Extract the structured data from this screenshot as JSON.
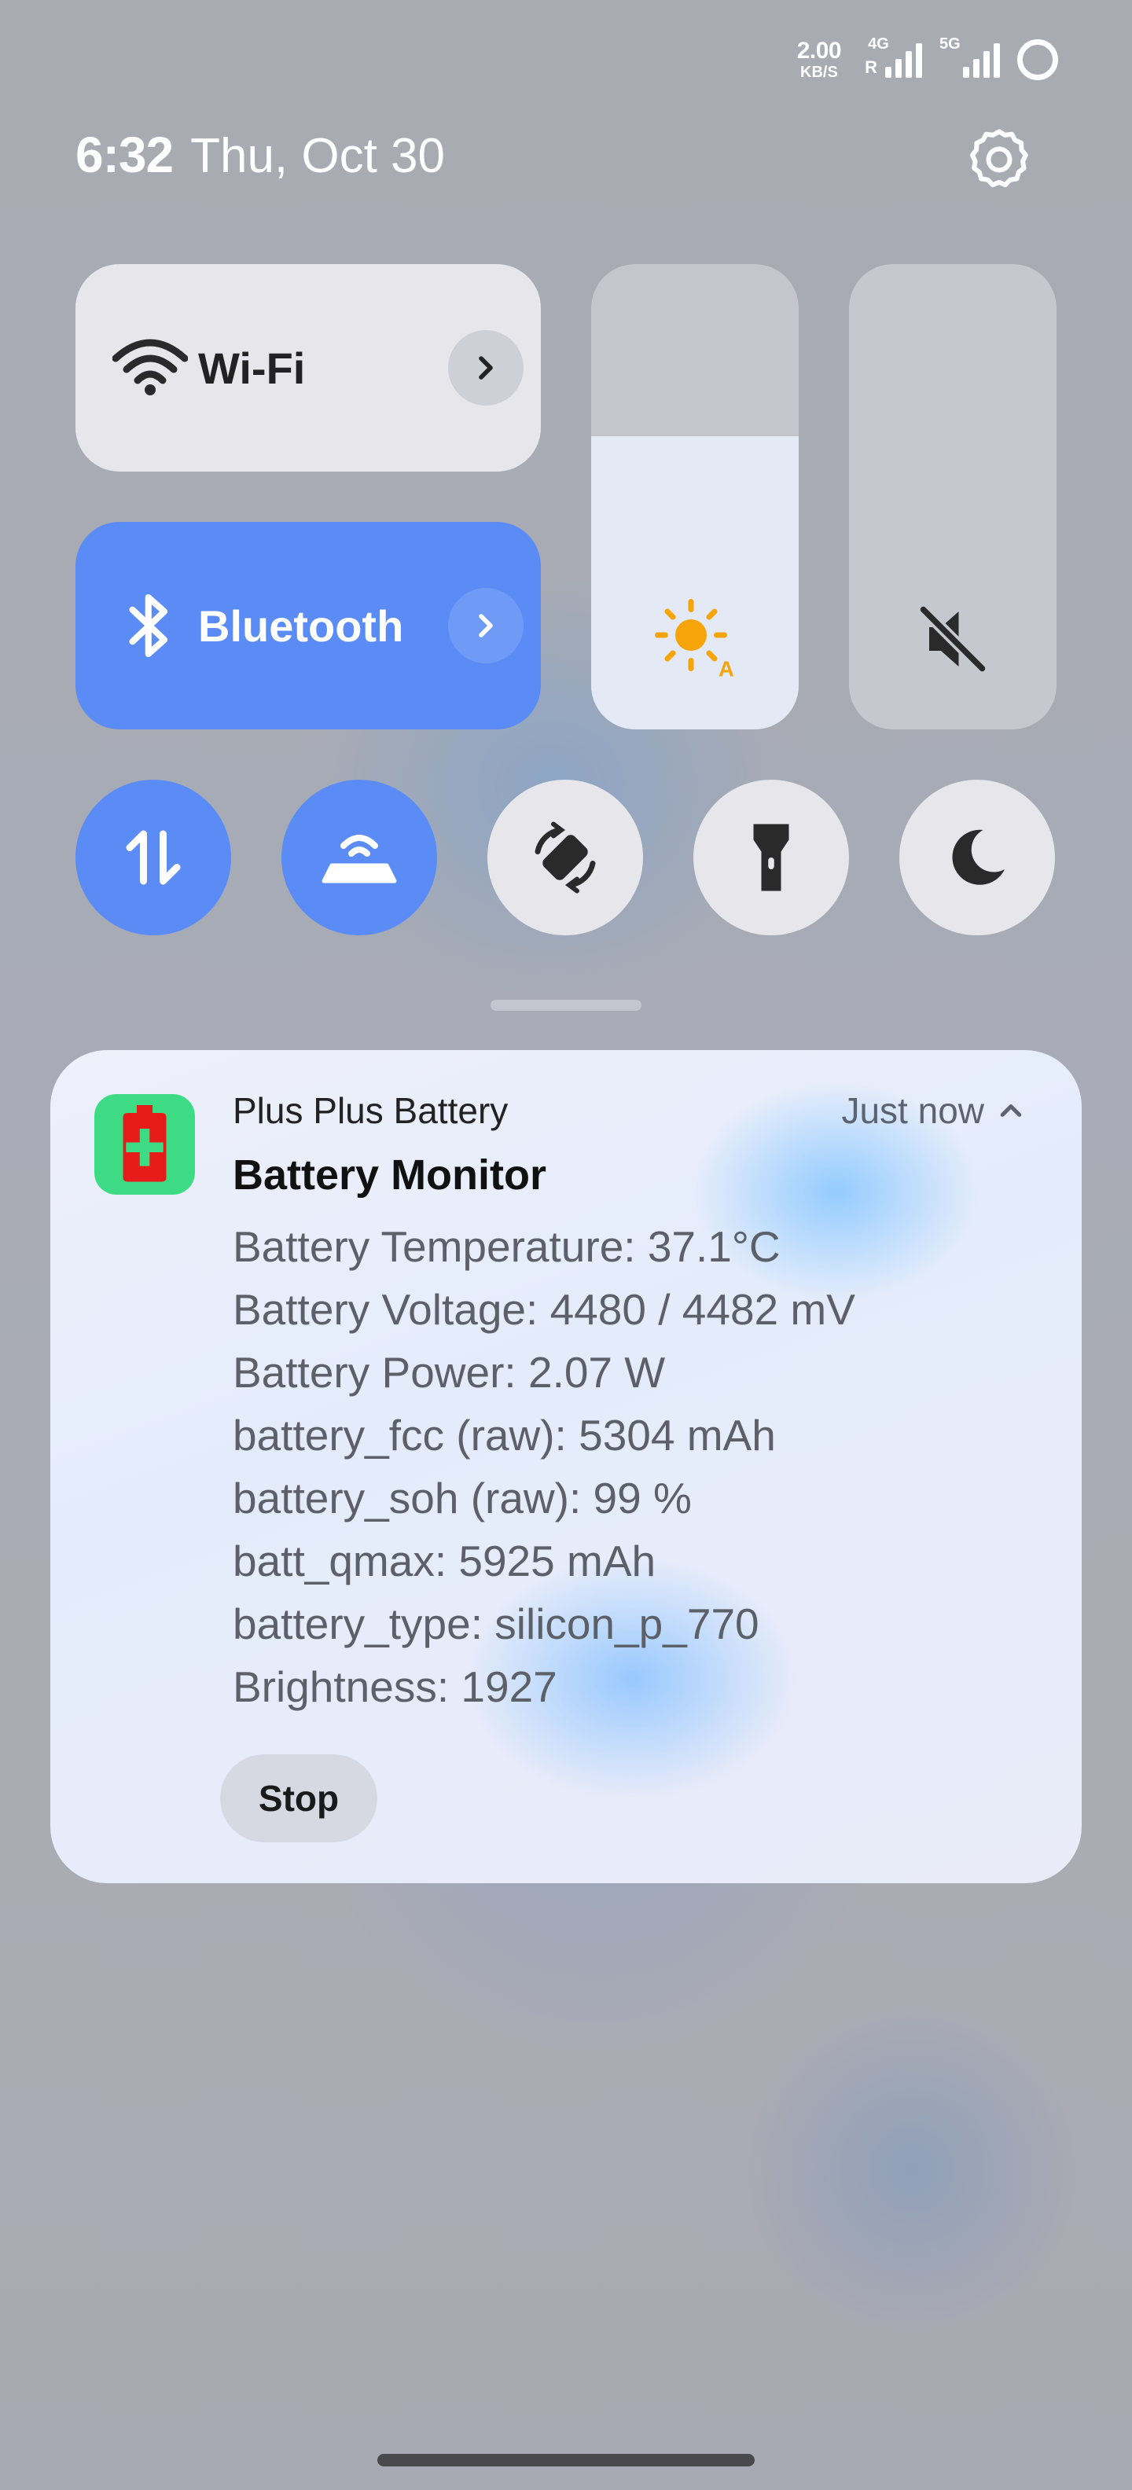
{
  "status_bar": {
    "net_speed_value": "2.00",
    "net_speed_unit": "KB/S",
    "sim1_tag": "4G",
    "sim1_roaming": "R",
    "sim2_tag": "5G"
  },
  "header": {
    "time": "6:32",
    "date": "Thu, Oct 30"
  },
  "quick_settings": {
    "wifi_label": "Wi-Fi",
    "bluetooth_label": "Bluetooth",
    "brightness_level": 0.63,
    "volume_muted": true,
    "toggles": [
      {
        "name": "mobile-data",
        "on": true
      },
      {
        "name": "hotspot",
        "on": true
      },
      {
        "name": "auto-rotate",
        "on": false
      },
      {
        "name": "flashlight",
        "on": false
      },
      {
        "name": "dark-mode",
        "on": false
      }
    ],
    "accent_color": "#5b8cf5"
  },
  "notification": {
    "app_name": "Plus Plus Battery",
    "time": "Just now",
    "title": "Battery Monitor",
    "lines": [
      "Battery Temperature: 37.1°C",
      "Battery Voltage: 4480 / 4482 mV",
      "Battery Power: 2.07 W",
      "battery_fcc (raw): 5304 mAh",
      "battery_soh (raw): 99 %",
      "batt_qmax: 5925 mAh",
      "battery_type: silicon_p_770",
      "Brightness: 1927"
    ],
    "action_label": "Stop",
    "icon_color": "#3ddc84"
  }
}
